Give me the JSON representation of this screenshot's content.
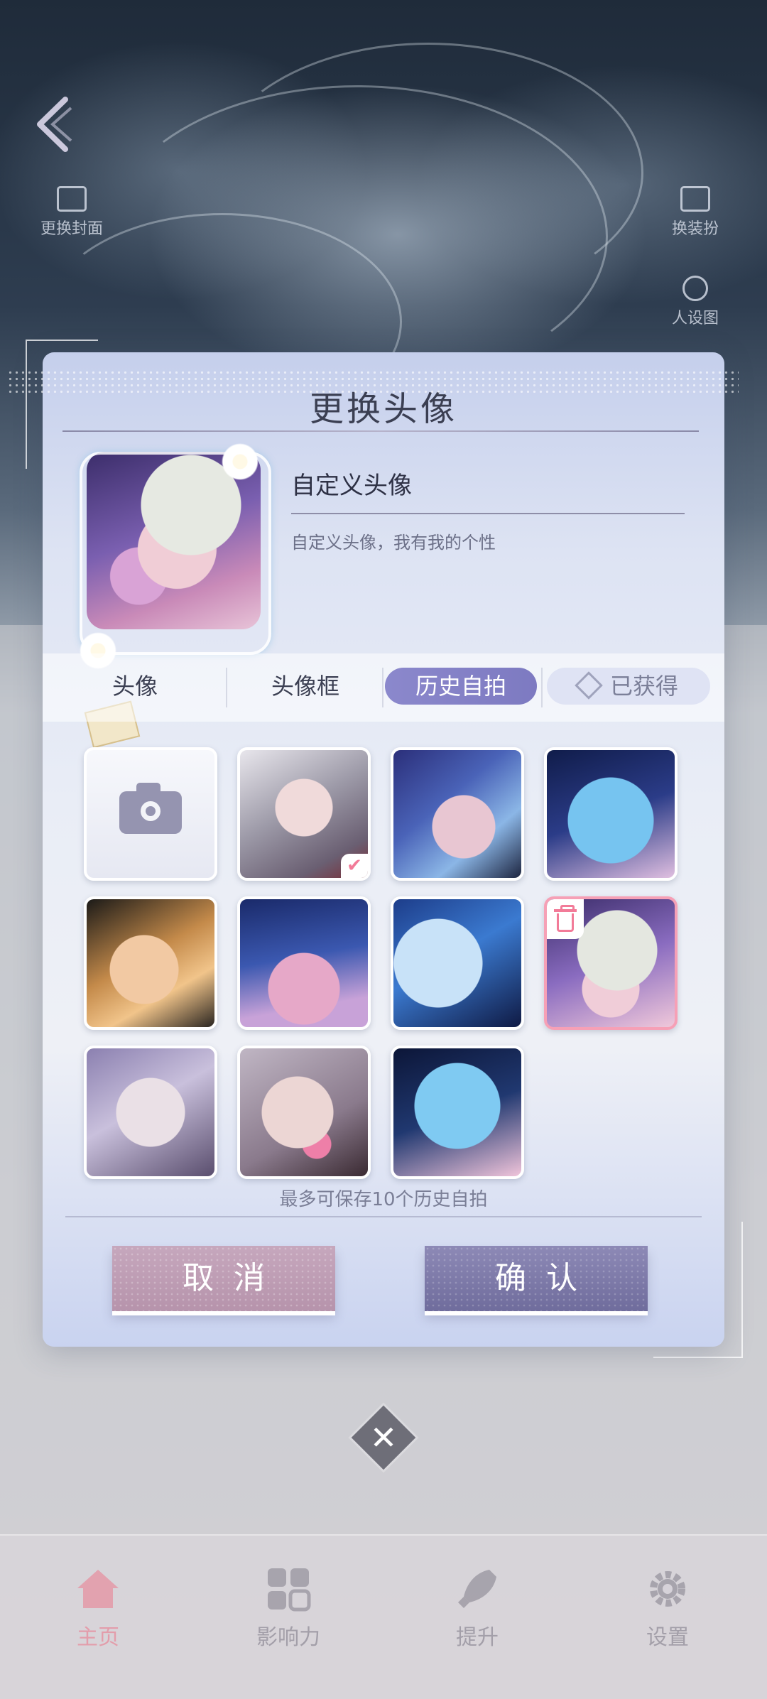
{
  "background": {
    "nav_left_label": "更换封面",
    "nav_right_label": "换装扮",
    "nav_right2_label": "人设图"
  },
  "dialog": {
    "title": "更换头像",
    "custom_avatar_title": "自定义头像",
    "custom_avatar_desc": "自定义头像，我有我的个性",
    "tabs": [
      {
        "label": "头像",
        "active": false
      },
      {
        "label": "头像框",
        "active": false
      },
      {
        "label": "历史自拍",
        "active": true
      },
      {
        "label": "已获得",
        "active": false
      }
    ],
    "grid": [
      {
        "type": "camera",
        "icon": "camera-icon"
      },
      {
        "type": "photo",
        "checked": true
      },
      {
        "type": "photo"
      },
      {
        "type": "photo"
      },
      {
        "type": "photo"
      },
      {
        "type": "photo"
      },
      {
        "type": "photo"
      },
      {
        "type": "photo",
        "selected": true,
        "delete": true
      },
      {
        "type": "photo"
      },
      {
        "type": "photo"
      },
      {
        "type": "photo"
      }
    ],
    "save_note": "最多可保存10个历史自拍",
    "cancel_label": "取消",
    "confirm_label": "确认"
  },
  "close_symbol": "✕",
  "bottom_nav": [
    {
      "label": "主页",
      "icon": "home-icon",
      "active": true
    },
    {
      "label": "影响力",
      "icon": "grid-icon",
      "active": false
    },
    {
      "label": "提升",
      "icon": "rocket-icon",
      "active": false
    },
    {
      "label": "设置",
      "icon": "gear-icon",
      "active": false
    }
  ],
  "colors": {
    "accent": "#8b88cc",
    "pink": "#f27b98",
    "cancel": "#b693ab",
    "confirm": "#6f6c9c"
  }
}
